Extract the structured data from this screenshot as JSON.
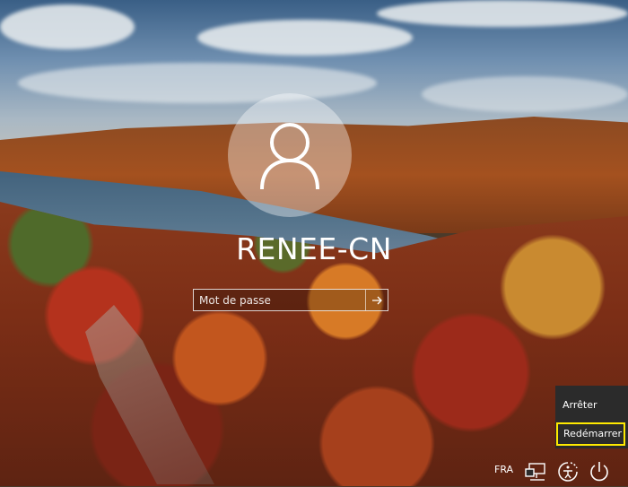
{
  "login": {
    "username": "RENEE-CN",
    "password_placeholder": "Mot de passe",
    "avatar_icon": "user-icon",
    "submit_icon": "arrow-right-icon"
  },
  "power_menu": {
    "items": [
      {
        "label": "Arrêter"
      },
      {
        "label": "Redémarrer",
        "highlighted": true
      }
    ],
    "highlight_color": "#ffea00"
  },
  "tray": {
    "language": "FRA",
    "icons": [
      "network-icon",
      "ease-of-access-icon",
      "power-icon"
    ]
  }
}
